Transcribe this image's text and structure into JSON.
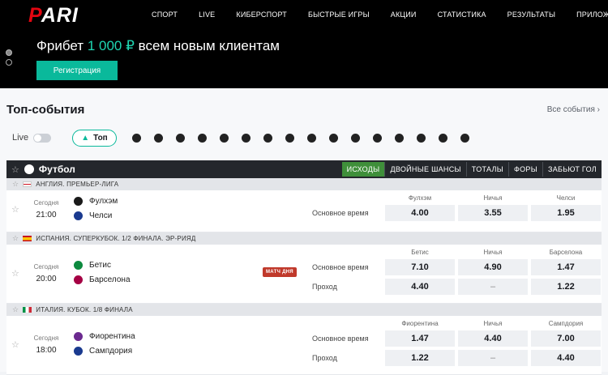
{
  "brand": {
    "logo_p": "P",
    "logo_rest": "ARI"
  },
  "nav": [
    "СПОРТ",
    "LIVE",
    "КИБЕРСПОРТ",
    "БЫСТРЫЕ ИГРЫ",
    "АКЦИИ",
    "СТАТИСТИКА",
    "РЕЗУЛЬТАТЫ",
    "ПРИЛОЖЕНИЯ"
  ],
  "banner": {
    "text_before": "Фрибет ",
    "amount": "1 000 ₽",
    "text_after": " всем новым клиентам",
    "register_label": "Регистрация"
  },
  "top_events": {
    "title": "Топ-события",
    "all_label": "Все события ›"
  },
  "filters": {
    "live_label": "Live",
    "top_label": "Топ",
    "sport_icons": [
      "soccer-ball-icon",
      "gamepad-icon",
      "football-icon",
      "tennis-icon",
      "table-tennis-icon",
      "basketball-icon",
      "volleyball-icon",
      "hockey-icon",
      "ball-icon",
      "ball-icon",
      "hockey-stick-icon",
      "mma-icon",
      "boxing-icon",
      "rugby-icon",
      "badminton-icon",
      "handball-icon"
    ]
  },
  "sport": {
    "name": "Футбол",
    "tabs": [
      "ИСХОДЫ",
      "ДВОЙНЫЕ ШАНСЫ",
      "ТОТАЛЫ",
      "ФОРЫ",
      "ЗАБЬЮТ ГОЛ"
    ],
    "active_tab": 0
  },
  "leagues": [
    {
      "name": "АНГЛИЯ. ПРЕМЬЕР-ЛИГА",
      "flag": "england",
      "match": {
        "date": "Сегодня",
        "time": "21:00",
        "team1": "Фулхэм",
        "team2": "Челси",
        "badge": "",
        "cols": [
          "Фулхэм",
          "Ничья",
          "Челси"
        ],
        "rows": [
          {
            "label": "Основное время",
            "odds": [
              "4.00",
              "3.55",
              "1.95"
            ]
          }
        ]
      }
    },
    {
      "name": "ИСПАНИЯ. СУПЕРКУБОК. 1/2 ФИНАЛА. ЭР-РИЯД",
      "flag": "spain",
      "match": {
        "date": "Сегодня",
        "time": "20:00",
        "team1": "Бетис",
        "team2": "Барселона",
        "badge": "МАТЧ ДНЯ",
        "cols": [
          "Бетис",
          "Ничья",
          "Барселона"
        ],
        "rows": [
          {
            "label": "Основное время",
            "odds": [
              "7.10",
              "4.90",
              "1.47"
            ]
          },
          {
            "label": "Проход",
            "odds": [
              "4.40",
              "–",
              "1.22"
            ]
          }
        ]
      }
    },
    {
      "name": "ИТАЛИЯ. КУБОК. 1/8 ФИНАЛА",
      "flag": "italy",
      "match": {
        "date": "Сегодня",
        "time": "18:00",
        "team1": "Фиорентина",
        "team2": "Сампдория",
        "badge": "",
        "cols": [
          "Фиорентина",
          "Ничья",
          "Сампдория"
        ],
        "rows": [
          {
            "label": "Основное время",
            "odds": [
              "1.47",
              "4.40",
              "7.00"
            ]
          },
          {
            "label": "Проход",
            "odds": [
              "1.22",
              "–",
              "4.40"
            ]
          }
        ]
      }
    }
  ],
  "colors": {
    "accent": "#0ab99b",
    "tab_active": "#3f8f3a",
    "header": "#24272c",
    "badge": "#c0392b"
  }
}
